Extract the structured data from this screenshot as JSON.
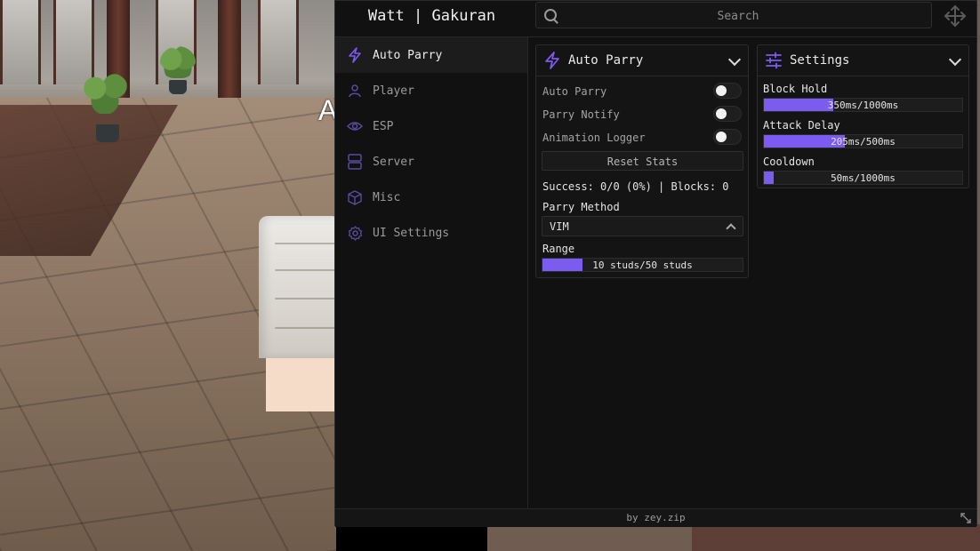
{
  "window": {
    "title": "Watt | Gakuran",
    "footer": "by zey.zip"
  },
  "search": {
    "placeholder": "Search"
  },
  "sidebar": {
    "items": [
      {
        "label": "Auto Parry",
        "icon": "lightning-icon",
        "active": true
      },
      {
        "label": "Player",
        "icon": "user-icon",
        "active": false
      },
      {
        "label": "ESP",
        "icon": "eye-icon",
        "active": false
      },
      {
        "label": "Server",
        "icon": "server-icon",
        "active": false
      },
      {
        "label": "Misc",
        "icon": "cube-icon",
        "active": false
      },
      {
        "label": "UI Settings",
        "icon": "gear-icon",
        "active": false
      }
    ]
  },
  "auto_parry": {
    "title": "Auto Parry",
    "toggles": [
      {
        "label": "Auto Parry",
        "on": false
      },
      {
        "label": "Parry Notify",
        "on": false
      },
      {
        "label": "Animation Logger",
        "on": false
      }
    ],
    "reset_label": "Reset Stats",
    "stats": "Success: 0/0 (0%) | Blocks: 0",
    "method_label": "Parry Method",
    "method_value": "VIM",
    "range_label": "Range",
    "range": {
      "text": "10 studs/50 studs",
      "value": 10,
      "max": 50
    }
  },
  "settings": {
    "title": "Settings",
    "sliders": [
      {
        "label": "Block Hold",
        "text": "350ms/1000ms",
        "value": 350,
        "max": 1000
      },
      {
        "label": "Attack Delay",
        "text": "205ms/500ms",
        "value": 205,
        "max": 500
      },
      {
        "label": "Cooldown",
        "text": "50ms/1000ms",
        "value": 50,
        "max": 1000
      }
    ]
  },
  "colors": {
    "accent": "#7b5cf0",
    "panel": "#111111"
  }
}
